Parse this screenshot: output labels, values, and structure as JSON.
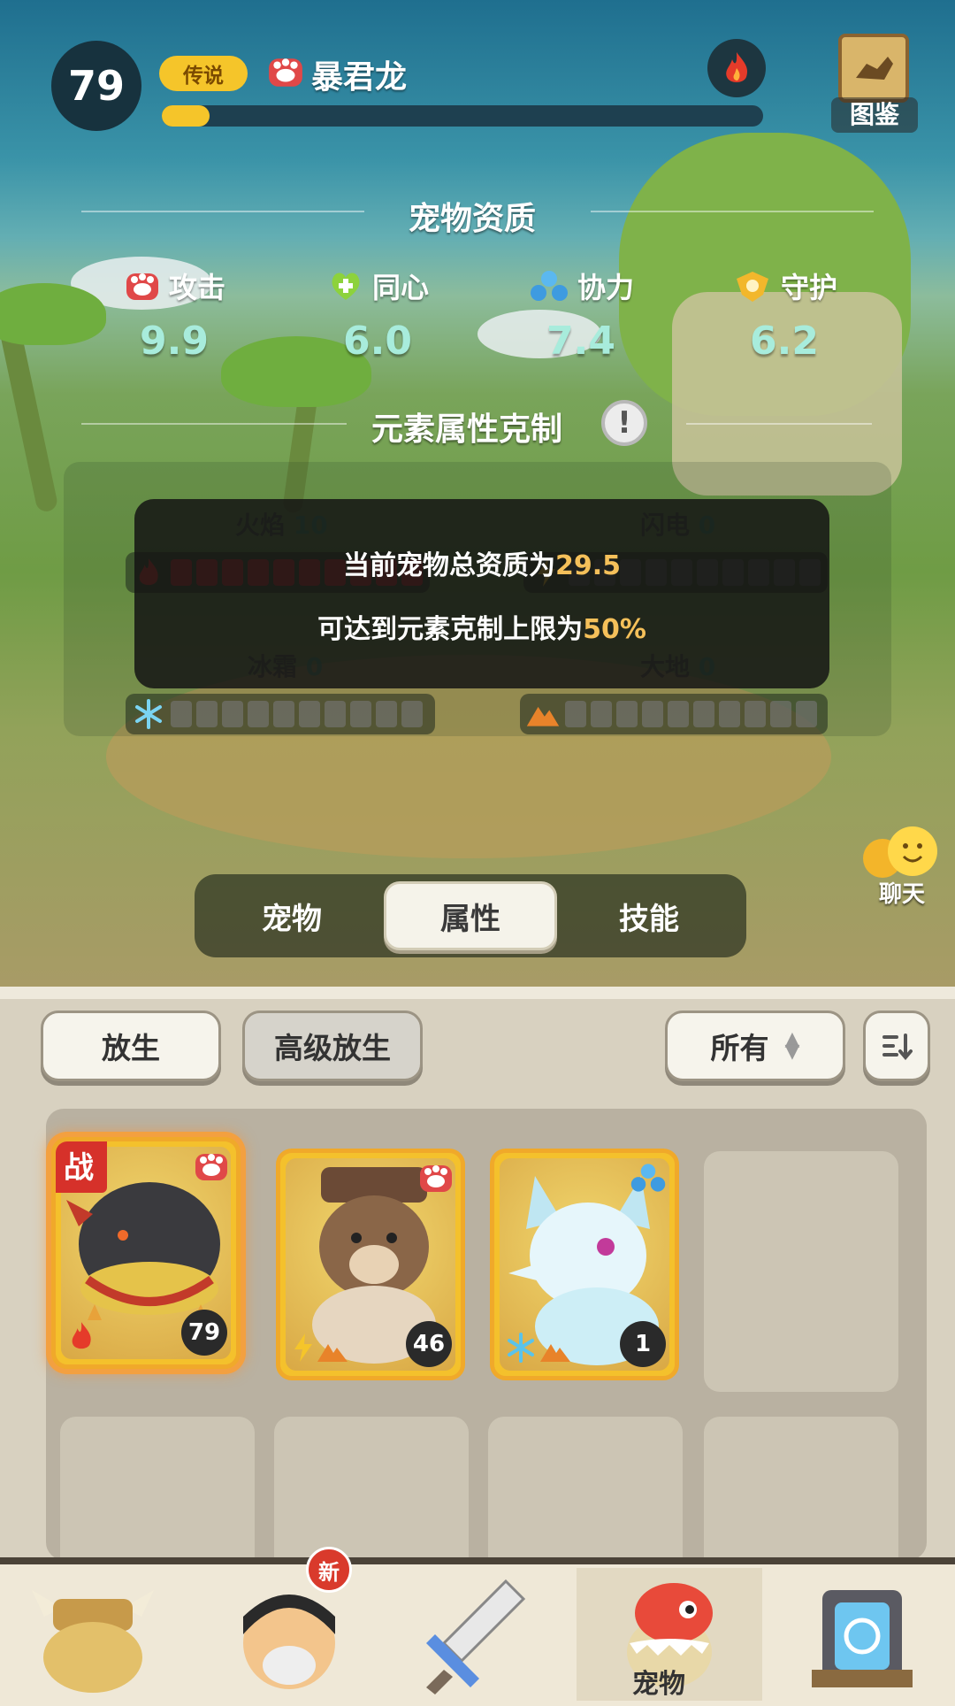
{
  "header": {
    "level": "79",
    "rarity": "传说",
    "pet_name": "暴君龙",
    "xp_fraction": 0.08,
    "codex_label": "图鉴"
  },
  "aptitude": {
    "title": "宠物资质",
    "stats": [
      {
        "label": "攻击",
        "value": "9.9",
        "icon": "paw-icon"
      },
      {
        "label": "同心",
        "value": "6.0",
        "icon": "heart-plus-icon"
      },
      {
        "label": "协力",
        "value": "7.4",
        "icon": "team-icon"
      },
      {
        "label": "守护",
        "value": "6.2",
        "icon": "shield-icon"
      }
    ]
  },
  "elements": {
    "title": "元素属性克制",
    "items": [
      {
        "name": "火焰",
        "value": "10",
        "filled": 10
      },
      {
        "name": "闪电",
        "value": "0",
        "filled": 0
      },
      {
        "name": "冰霜",
        "value": "0",
        "filled": 0
      },
      {
        "name": "大地",
        "value": "0",
        "filled": 0
      }
    ]
  },
  "tooltip": {
    "line1_prefix": "当前宠物总资质为",
    "line1_value": "29.5",
    "line2_prefix": "可达到元素克制上限为",
    "line2_value": "50%"
  },
  "chat_label": "聊天",
  "tabs": [
    "宠物",
    "属性",
    "技能"
  ],
  "active_tab": 1,
  "toolbar": {
    "release_label": "放生",
    "advanced_release_label": "高级放生",
    "filter_label": "所有"
  },
  "pets": [
    {
      "level": "79",
      "battle_tag": "战",
      "element": "fire"
    },
    {
      "level": "46",
      "element": "lightning-earth"
    },
    {
      "level": "1",
      "element": "ice-earth"
    }
  ],
  "nav": {
    "new_badge": "新",
    "active_label": "宠物"
  },
  "colors": {
    "accent_gold": "#f5c52a",
    "stat_value": "#a8ecdc",
    "fire_red": "#c9302c",
    "tooltip_highlight": "#f5c05a"
  }
}
